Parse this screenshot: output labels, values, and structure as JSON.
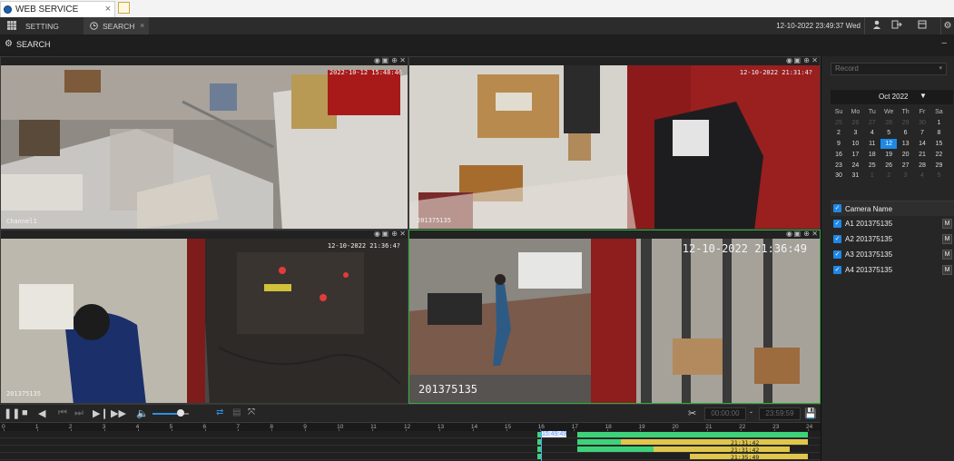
{
  "browser": {
    "tab_title": "WEB SERVICE",
    "close": "×"
  },
  "app": {
    "tabs": [
      {
        "label": "SETTING"
      },
      {
        "label": "SEARCH"
      }
    ],
    "datetime": "12-10-2022 23:49:37 Wed"
  },
  "page": {
    "title": "SEARCH"
  },
  "panes": [
    {
      "osd_time": "2022-10-12 15:48:46",
      "name": "Channel1"
    },
    {
      "osd_time": "12-10-2022 21:31:4?",
      "name": "201375135"
    },
    {
      "osd_time": "12-10-2022 21:36:4?",
      "name": "201375135"
    },
    {
      "osd_time": "12-10-2022 21:36:49",
      "name": "201375135"
    }
  ],
  "controls": {
    "start_time": "00:00:00",
    "dash": "-",
    "end_time": "23:59:59"
  },
  "timeline": {
    "hours": [
      "0",
      "1",
      "2",
      "3",
      "4",
      "5",
      "6",
      "7",
      "8",
      "9",
      "10",
      "11",
      "12",
      "13",
      "14",
      "15",
      "16",
      "17",
      "18",
      "19",
      "20",
      "21",
      "22",
      "23",
      "24"
    ],
    "cursor_label": "15:49:49",
    "seg_labels": [
      "21:31:42",
      "21:31:42",
      "21:35:49"
    ]
  },
  "right": {
    "record_type": "Record",
    "month": "Oct 2022",
    "weekdays": [
      "Su",
      "Mo",
      "Tu",
      "We",
      "Th",
      "Fr",
      "Sa"
    ],
    "days": [
      [
        "25",
        "26",
        "27",
        "28",
        "29",
        "30",
        "1"
      ],
      [
        "2",
        "3",
        "4",
        "5",
        "6",
        "7",
        "8"
      ],
      [
        "9",
        "10",
        "11",
        "12",
        "13",
        "14",
        "15"
      ],
      [
        "16",
        "17",
        "18",
        "19",
        "20",
        "21",
        "22"
      ],
      [
        "23",
        "24",
        "25",
        "26",
        "27",
        "28",
        "29"
      ],
      [
        "30",
        "31",
        "1",
        "2",
        "3",
        "4",
        "5"
      ]
    ],
    "selected_day": "12",
    "camera_header": "Camera Name",
    "cameras": [
      "A1 201375135",
      "A2 201375135",
      "A3 201375135",
      "A4 201375135"
    ],
    "m_label": "M"
  },
  "colors": {
    "accent": "#1e88e5",
    "selected_border": "#2fae3a",
    "record_green": "#3dd27a",
    "record_yellow": "#e0c64a"
  }
}
